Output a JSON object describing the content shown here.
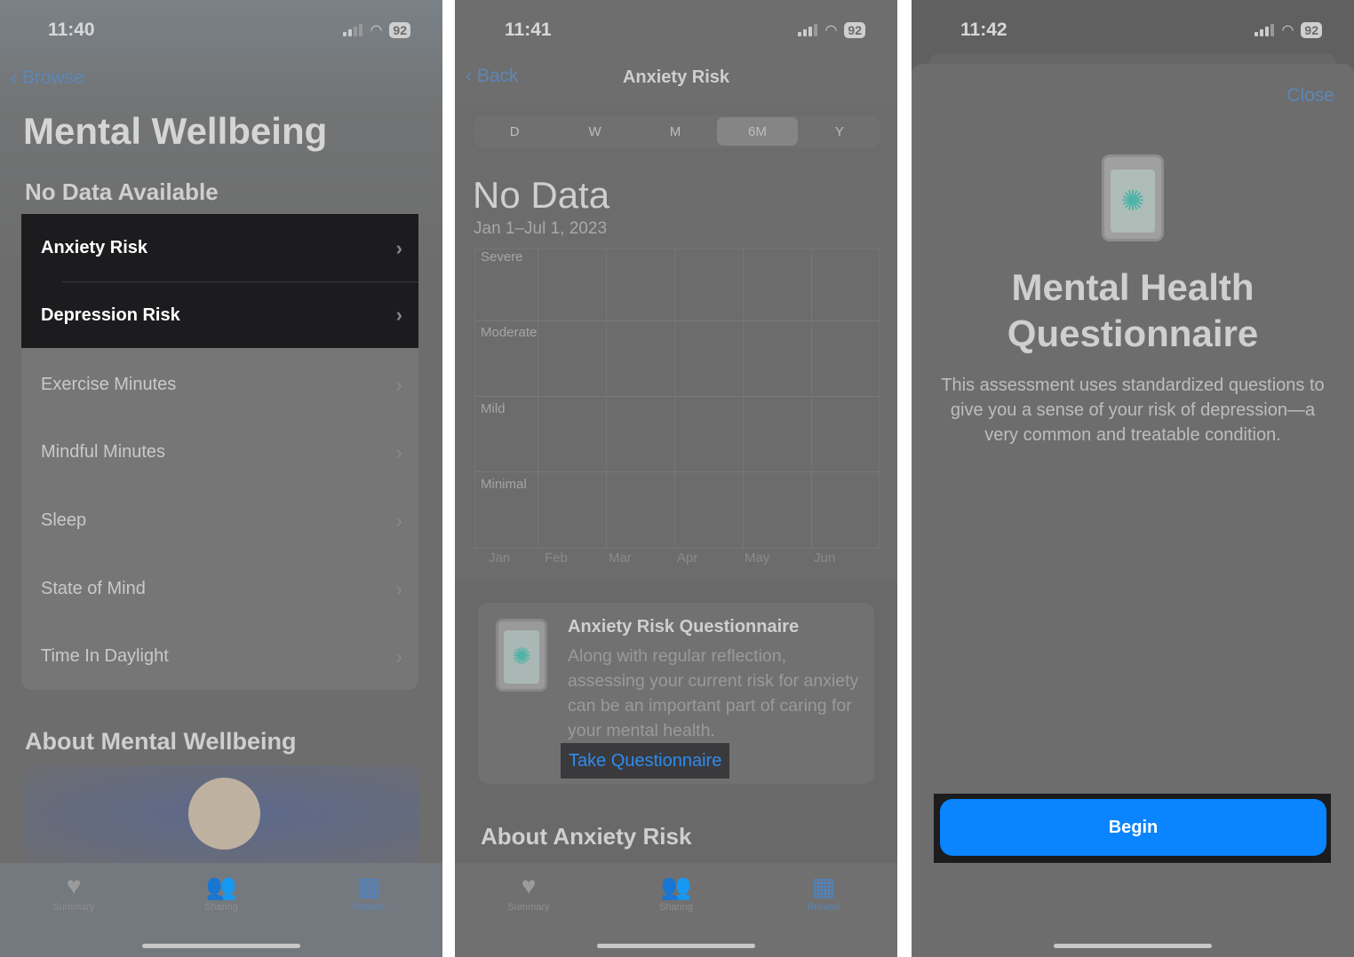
{
  "panel1": {
    "time": "11:40",
    "battery": "92",
    "back": "Browse",
    "title": "Mental Wellbeing",
    "section": "No Data Available",
    "items": [
      "Anxiety Risk",
      "Depression Risk",
      "Exercise Minutes",
      "Mindful Minutes",
      "Sleep",
      "State of Mind",
      "Time In Daylight"
    ],
    "about": "About Mental Wellbeing"
  },
  "panel2": {
    "time": "11:41",
    "battery": "92",
    "back": "Back",
    "title": "Anxiety Risk",
    "segments": [
      "D",
      "W",
      "M",
      "6M",
      "Y"
    ],
    "selected_segment": "6M",
    "headline": "No Data",
    "date_range": "Jan 1–Jul 1, 2023",
    "chart_levels": [
      "Severe",
      "Moderate",
      "Mild",
      "Minimal"
    ],
    "months": [
      "Jan",
      "Feb",
      "Mar",
      "Apr",
      "May",
      "Jun"
    ],
    "card": {
      "title": "Anxiety Risk Questionnaire",
      "body": "Along with regular reflection, assessing your current risk for anxiety can be an important part of caring for your mental health.",
      "link": "Take Questionnaire"
    },
    "about": "About Anxiety Risk"
  },
  "tabs": [
    "Summary",
    "Sharing",
    "Browse"
  ],
  "panel3": {
    "time": "11:42",
    "battery": "92",
    "close": "Close",
    "title": "Mental Health Questionnaire",
    "body": "This assessment uses standardized questions to give you a sense of your risk of depression—a very common and treatable condition.",
    "begin": "Begin"
  },
  "colors": {
    "accent": "#0a84ff",
    "highlight": "#1c1c1e"
  }
}
